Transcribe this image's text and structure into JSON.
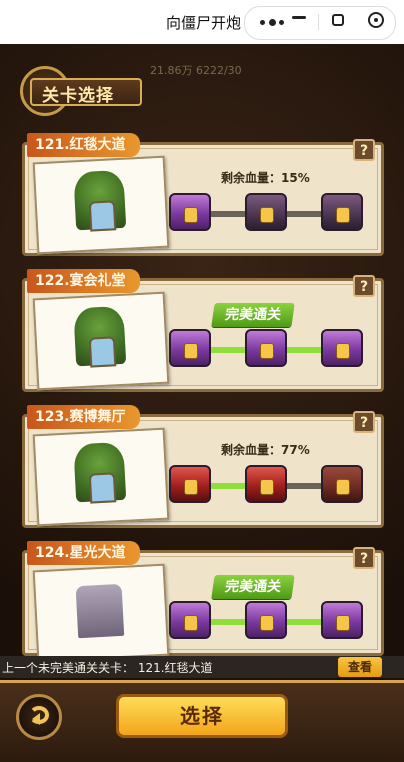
{
  "topbar": {
    "title": "向僵尸开炮"
  },
  "background": {
    "stats_text": "21.86万    6222/30"
  },
  "header": {
    "title": "关卡选择"
  },
  "levels": [
    {
      "title": "121.红毯大道",
      "status": "剩余血量：15%",
      "thumb": "forest-shrine",
      "chest_style": [
        "purple",
        "purple-dark",
        "purple-dark"
      ],
      "progress_track": "gray"
    },
    {
      "title": "122.宴会礼堂",
      "status": "完美通关",
      "thumb": "forest-shrine",
      "chest_style": [
        "purple",
        "purple",
        "purple"
      ],
      "progress_track": "green"
    },
    {
      "title": "123.赛博舞厅",
      "status": "剩余血量：77%",
      "thumb": "forest-shrine",
      "chest_style": [
        "red",
        "red",
        "red-dark"
      ],
      "progress_track": "mixed"
    },
    {
      "title": "124.星光大道",
      "status": "完美通关",
      "thumb": "stone-ruin",
      "chest_style": [
        "purple",
        "purple",
        "purple"
      ],
      "progress_track": "green"
    }
  ],
  "last_incomplete": {
    "text": "上一个未完美通关关卡：  121.红毯大道",
    "view_label": "查看"
  },
  "bottom": {
    "select_label": "选择"
  },
  "colors": {
    "accent_gold": "#f3a51a",
    "perfect_green": "#8fde3a",
    "card_bg": "#efe4c9"
  }
}
